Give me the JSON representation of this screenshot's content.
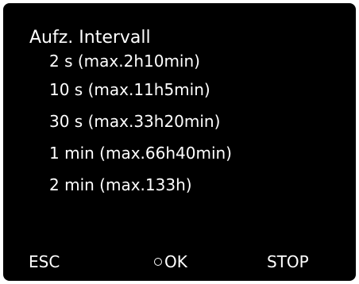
{
  "screen": {
    "title": "Aufz. Intervall",
    "options": [
      "2 s (max.2h10min)",
      "10 s (max.11h5min)",
      "30 s (max.33h20min)",
      "1 min (max.66h40min)",
      "2 min (max.133h)"
    ]
  },
  "softkeys": {
    "esc": "ESC",
    "ok": "OK",
    "ok_icon": "ring-icon",
    "stop": "STOP"
  },
  "colors": {
    "background": "#000000",
    "text": "#ffffff"
  }
}
